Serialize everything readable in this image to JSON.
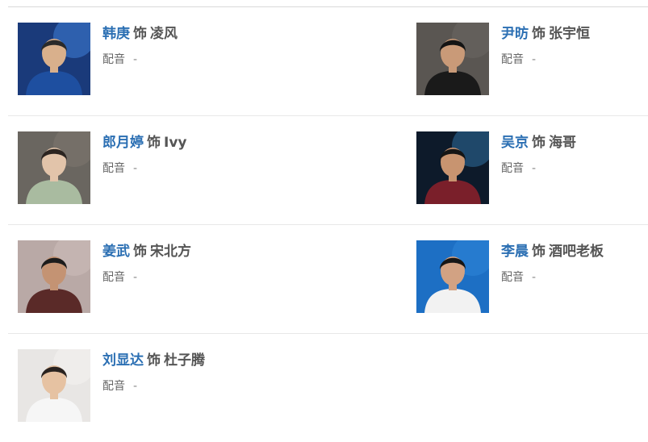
{
  "cast": [
    {
      "actor": "韩庚",
      "as": "饰",
      "role": "凌风",
      "voice_label": "配音",
      "voice_value": "-",
      "photo": {
        "bg": "#1a3a7a",
        "accent": "#3f7fd8",
        "skin": "#d9b08c",
        "hair": "#2a2a2a",
        "clothes": "#1e4fa0"
      }
    },
    {
      "actor": "尹昉",
      "as": "饰",
      "role": "张宇恒",
      "voice_label": "配音",
      "voice_value": "-",
      "photo": {
        "bg": "#5a5652",
        "accent": "#6b6762",
        "skin": "#c99a78",
        "hair": "#141414",
        "clothes": "#1a1a1a"
      }
    },
    {
      "actor": "郎月婷",
      "as": "饰",
      "role": "Ivy",
      "voice_label": "配音",
      "voice_value": "-",
      "photo": {
        "bg": "#6a6660",
        "accent": "#7d7770",
        "skin": "#e2c4aa",
        "hair": "#2b2420",
        "clothes": "#a9bba0"
      }
    },
    {
      "actor": "吴京",
      "as": "饰",
      "role": "海哥",
      "voice_label": "配音",
      "voice_value": "-",
      "photo": {
        "bg": "#0d1a2a",
        "accent": "#2f6f9f",
        "skin": "#c89470",
        "hair": "#151515",
        "clothes": "#7a1f2a"
      }
    },
    {
      "actor": "姜武",
      "as": "饰",
      "role": "宋北方",
      "voice_label": "配音",
      "voice_value": "-",
      "photo": {
        "bg": "#b9a9a6",
        "accent": "#cdbdb9",
        "skin": "#c49373",
        "hair": "#1c1c1c",
        "clothes": "#5a2a28"
      }
    },
    {
      "actor": "李晨",
      "as": "饰",
      "role": "酒吧老板",
      "voice_label": "配音",
      "voice_value": "-",
      "photo": {
        "bg": "#1d6fc4",
        "accent": "#2d85d8",
        "skin": "#d2a283",
        "hair": "#161616",
        "clothes": "#f2f2f2"
      }
    },
    {
      "actor": "刘显达",
      "as": "饰",
      "role": "杜子腾",
      "voice_label": "配音",
      "voice_value": "-",
      "photo": {
        "bg": "#e8e6e4",
        "accent": "#f4f2f0",
        "skin": "#e6c2a2",
        "hair": "#2a2320",
        "clothes": "#f6f6f6"
      }
    }
  ]
}
